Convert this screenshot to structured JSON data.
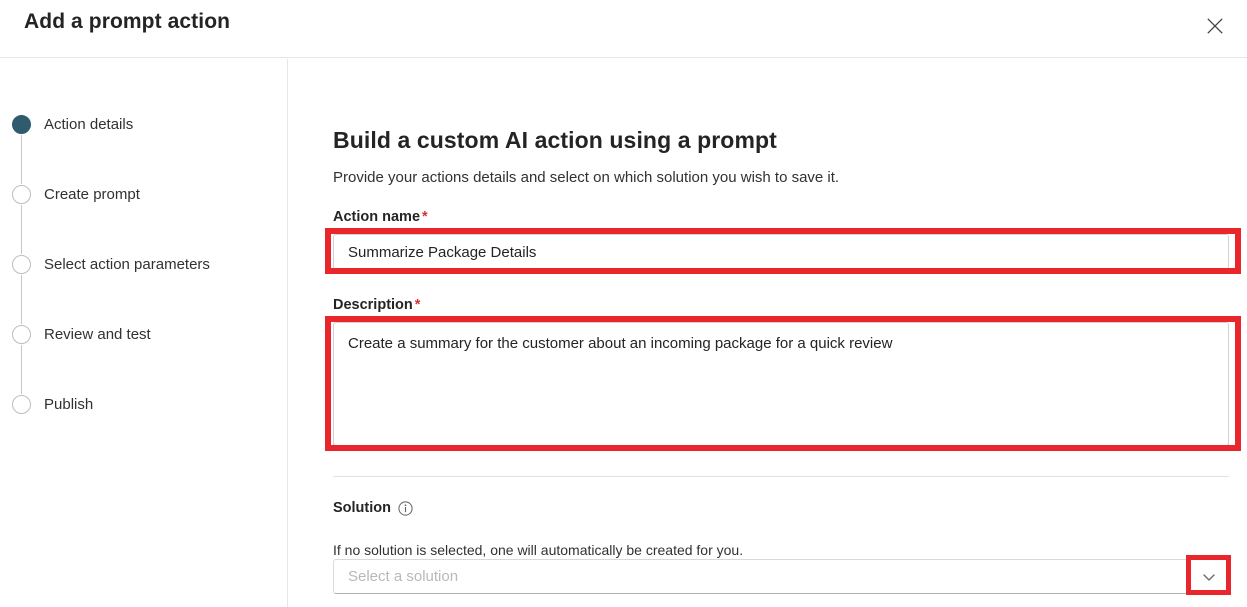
{
  "dialog": {
    "title": "Add a prompt action",
    "close_icon": "close-icon"
  },
  "stepper": {
    "steps": [
      {
        "label": "Action details",
        "state": "active"
      },
      {
        "label": "Create prompt",
        "state": "inactive"
      },
      {
        "label": "Select action parameters",
        "state": "inactive"
      },
      {
        "label": "Review and test",
        "state": "inactive"
      },
      {
        "label": "Publish",
        "state": "inactive"
      }
    ]
  },
  "main": {
    "heading": "Build a custom AI action using a prompt",
    "subheading": "Provide your actions details and select on which solution you wish to save it.",
    "fields": {
      "action_name": {
        "label": "Action name",
        "required_marker": "*",
        "value": "Summarize Package Details",
        "placeholder": ""
      },
      "description": {
        "label": "Description",
        "required_marker": "*",
        "value": "Create a summary for the customer about an incoming package for a quick review",
        "placeholder": ""
      },
      "solution": {
        "label": "Solution",
        "info_icon": "info-circle-icon",
        "help_text": "If no solution is selected, one will automatically be created for you.",
        "placeholder": "Select a solution",
        "value": "",
        "chevron_icon": "chevron-down-icon"
      }
    }
  },
  "annotations": {
    "color": "#e8262b",
    "targets": [
      "action-name-input",
      "description-textarea",
      "solution-chevron"
    ]
  },
  "colors": {
    "active_step": "#2e5c6e",
    "required_star": "#d13438",
    "focus_underline": "#3c6a7e",
    "annotation_red": "#e8262b"
  }
}
